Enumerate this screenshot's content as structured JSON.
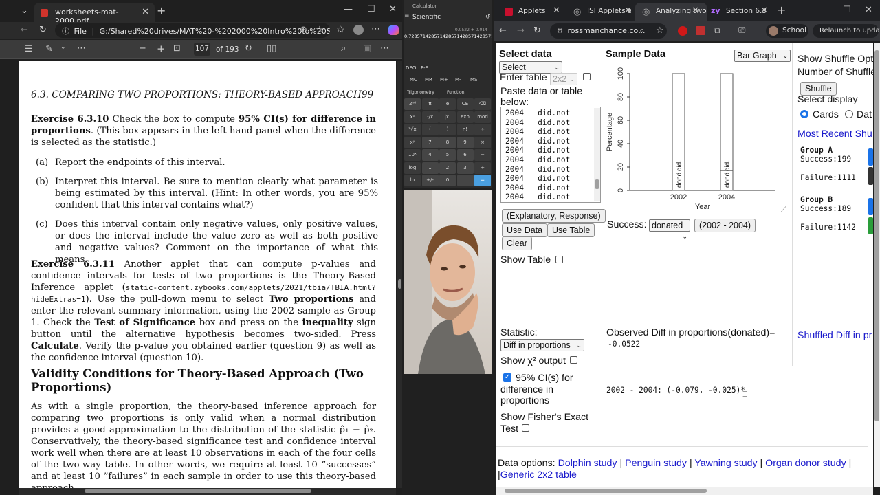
{
  "pdf": {
    "tab_title": "worksheets-mat-2000.pdf",
    "address_prefix": "File",
    "address": "G:/Shared%20drives/MAT%20-%202000%20Intro%20to%20Stats/wo...",
    "page_current": "107",
    "page_total": "of 193",
    "header": "6.3. COMPARING TWO PROPORTIONS: THEORY-BASED APPROACH",
    "header_page": "99",
    "ex1_label": "Exercise 6.3.10",
    "ex1_text_a": " Check the box to compute ",
    "ex1_bold": "95% CI(s) for difference in proportions",
    "ex1_text_b": ". (This box appears in the left-hand panel when the difference is selected as the statistic.)",
    "a_label": "(a)",
    "a_text": "Report the endpoints of this interval.",
    "b_label": "(b)",
    "b_text": "Interpret this interval.  Be sure to mention clearly what parameter is being estimated by this interval.  (Hint: In other words, you are 95% confident that this interval contains what?)",
    "c_label": "(c)",
    "c_text": "Does this interval contain only negative values, only positive values, or does the interval include the value zero as well as both positive and negative values? Comment on the importance of what this means.",
    "ex2_label": "Exercise 6.3.11",
    "ex2_text_a": " Another applet that can compute p-values and confidence intervals for tests of two proportions is the Theory-Based Inference applet (",
    "ex2_url": "static-content.zybooks.com/applets/2021/tbia/TBIA.html?hideExtras=1",
    "ex2_text_b": ").   Use the pull-down menu to select ",
    "ex2_b1": "Two proportions",
    "ex2_text_c": " and enter the relevant summary information, using the 2002 sample as Group 1.  Check the ",
    "ex2_b2": "Test of Significance",
    "ex2_text_d": " box and press on the ",
    "ex2_b3": "inequality",
    "ex2_text_e": " sign button until the alternative hypothesis becomes two-sided.  Press ",
    "ex2_b4": "Calculate",
    "ex2_text_f": ".  Verify the p-value you obtained earlier (question 9) as well as the confidence interval (question 10).",
    "section_title": "Validity Conditions for Theory-Based Approach (Two Proportions)",
    "para": "As with a single proportion, the theory-based inference approach for comparing two proportions is only valid when a normal distribution provides a good approximation to the distribution of the statistic p̂₁ − p̂₂. Conservatively, the theory-based significance test and confidence interval work well when there are at least 10 observations in each of the four cells of the two-way table. In other words, we require at least 10 ”successes” and at least 10 ”failures” in each sample in order to use this theory-based approach."
  },
  "calc": {
    "title": "Calculator",
    "mode": "Scientific",
    "expr": "0.0522 + 0.014 -",
    "display": "0.72857142857142857142857142857142857142857142857",
    "mem": [
      "MC",
      "MR",
      "M+",
      "M-",
      "MS"
    ],
    "deg": "DEG",
    "fe": "F-E",
    "trig": "Trigonometry",
    "func": "Function",
    "keys": [
      [
        "2ⁿᵈ",
        "π",
        "e",
        "CE",
        "⌫"
      ],
      [
        "x²",
        "¹/x",
        "|x|",
        "exp",
        "mod"
      ],
      [
        "²√x",
        "(",
        ")",
        "n!",
        "÷"
      ],
      [
        "xʸ",
        "7",
        "8",
        "9",
        "×"
      ],
      [
        "10ˣ",
        "4",
        "5",
        "6",
        "−"
      ],
      [
        "log",
        "1",
        "2",
        "3",
        "+"
      ],
      [
        "ln",
        "+/-",
        "0",
        ".",
        "="
      ]
    ]
  },
  "browser": {
    "tabs": [
      "Applets",
      "ISI Applets and...",
      "Analyzing two...",
      "Section 6.3 -"
    ],
    "address": "rossmanchance.co...",
    "profile": "School",
    "relaunch": "Relaunch to update"
  },
  "applet": {
    "select_data": "Select data",
    "select_value": "Select",
    "enter_table": "Enter table",
    "enter_table_sel": "2x2",
    "paste_label": "Paste data or table below:",
    "rows": [
      [
        "2004",
        "did.not"
      ],
      [
        "2004",
        "did.not"
      ],
      [
        "2004",
        "did.not"
      ],
      [
        "2004",
        "did.not"
      ],
      [
        "2004",
        "did.not"
      ],
      [
        "2004",
        "did.not"
      ],
      [
        "2004",
        "did.not"
      ],
      [
        "2004",
        "did.not"
      ],
      [
        "2004",
        "did.not"
      ],
      [
        "2004",
        "did.not"
      ]
    ],
    "explanatory": "(Explanatory, Response)",
    "use_data": "Use Data",
    "use_table": "Use Table",
    "clear": "Clear",
    "show_table": "Show Table",
    "sample_data": "Sample Data",
    "graph_type": "Bar Graph",
    "success_label": "Success:",
    "success_value": "donated",
    "diff_button": "(2002 - 2004)",
    "statistic_label": "Statistic:",
    "statistic_value": "Diff in proportions",
    "chi_label": "Show χ² output",
    "ci_label": "95% CI(s) for difference in proportions",
    "fisher_label": "Show Fisher's Exact Test",
    "observed_label": "Observed Diff in proportions(donated)=",
    "observed_value": "-0.0522",
    "ci_result": "2002 - 2004: (-0.079, -0.025)*",
    "shuffle_opts": "Show Shuffle Opt",
    "num_shuffles": "Number of Shuffle",
    "shuffle_btn": "Shuffle",
    "select_display": "Select display",
    "cards": "Cards",
    "data_opt": "Dat",
    "most_recent": "Most Recent Shu",
    "groupA": "Group A",
    "groupA_success": "Success:199",
    "groupA_failure": "Failure:1111",
    "groupB": "Group B",
    "groupB_success": "Success:189",
    "groupB_failure": "Failure:1142",
    "shuffled_diff": "Shuffled Diff in pr",
    "data_options_label": "Data options:",
    "data_links": [
      "Dolphin study",
      "Penguin study",
      "Yawning study",
      "Organ donor study",
      "Generic 2x2 table"
    ]
  },
  "chart_data": {
    "type": "bar",
    "categories": [
      "2002",
      "2004"
    ],
    "series": [
      {
        "name": "donated",
        "values": [
          15,
          17
        ]
      },
      {
        "name": "did.not",
        "values": [
          85,
          83
        ]
      }
    ],
    "bar_labels": [
      "dond",
      "did."
    ],
    "xlabel": "Year",
    "ylabel": "Percentage",
    "yticks": [
      "0",
      "20",
      "40",
      "60",
      "80",
      "100"
    ],
    "ylim": [
      0,
      100
    ],
    "stacked": true
  }
}
